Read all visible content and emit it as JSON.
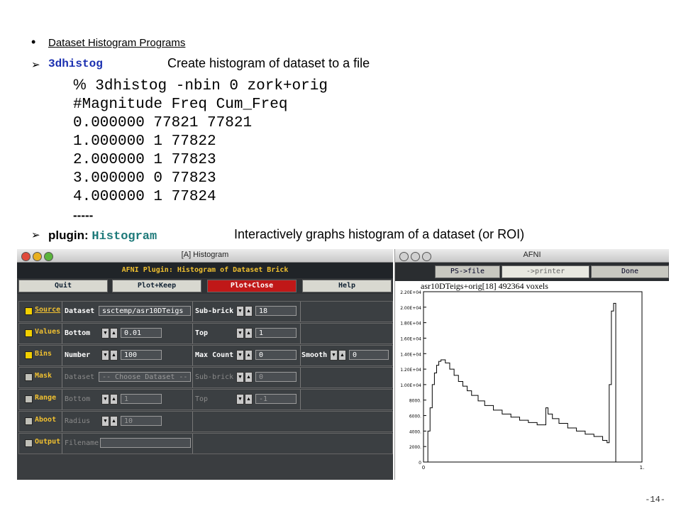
{
  "bullet1": {
    "text": "Dataset Histogram Programs"
  },
  "item1": {
    "cmd": "3dhistog",
    "desc": "Create histogram of dataset to a file"
  },
  "code": {
    "prompt": "%",
    "command": "3dhistog -nbin 0 zork+orig",
    "lines": [
      "#Magnitude Freq Cum_Freq",
      "0.000000 77821 77821",
      "1.000000 1 77822",
      "2.000000 1 77823",
      "3.000000 0 77823",
      "4.000000 1 77824",
      "-----"
    ]
  },
  "item2": {
    "prefix": "plugin:",
    "cmd": "Histogram",
    "desc": "Interactively graphs histogram of a dataset (or ROI)"
  },
  "page_number": "-14-",
  "plugin_window": {
    "title": "[A] Histogram",
    "header": "AFNI Plugin: Histogram of Dataset Brick",
    "buttons": [
      "Quit",
      "Plot+Keep",
      "Plot+Close",
      "Help"
    ],
    "rows": [
      {
        "label": "Source",
        "checked": true,
        "f1": "Dataset",
        "v1": "ssctemp/asr10DTeigs",
        "f2": "Sub-brick",
        "v2": "18",
        "f3": "",
        "v3": ""
      },
      {
        "label": "Values",
        "checked": true,
        "f1": "Bottom",
        "v1": "0.01",
        "f2": "Top",
        "v2": "1",
        "f3": "",
        "v3": ""
      },
      {
        "label": "Bins",
        "checked": true,
        "f1": "Number",
        "v1": "100",
        "f2": "Max Count",
        "v2": "0",
        "f3": "Smooth",
        "v3": "0"
      },
      {
        "label": "Mask",
        "checked": false,
        "f1": "Dataset",
        "v1": "-- Choose Dataset --",
        "f2": "Sub-brick",
        "v2": "0",
        "f3": "",
        "v3": ""
      },
      {
        "label": "Range",
        "checked": false,
        "f1": "Bottom",
        "v1": "1",
        "f2": "Top",
        "v2": "-1",
        "f3": "",
        "v3": ""
      },
      {
        "label": "Aboot",
        "checked": false,
        "f1": "Radius",
        "v1": "10",
        "f2": "",
        "v2": "",
        "f3": "",
        "v3": ""
      },
      {
        "label": "Output",
        "checked": false,
        "f1": "Filename",
        "v1": "",
        "f2": "",
        "v2": "",
        "f3": "",
        "v3": ""
      }
    ]
  },
  "afni_window": {
    "title": "AFNI",
    "buttons": [
      "PS->file",
      "->printer",
      "Done"
    ],
    "caption": "asr10DTeigs+orig[18] 492364 voxels"
  },
  "chart_data": {
    "type": "line",
    "title": "asr10DTeigs+orig[18] 492364 voxels",
    "xlim": [
      0,
      1.0
    ],
    "ylim": [
      0,
      22000
    ],
    "yticks": [
      "2.20E+04",
      "2.00E+04",
      "1.80E+04",
      "1.60E+04",
      "1.40E+04",
      "1.20E+04",
      "1.00E+04",
      "8000.",
      "6000.",
      "4000.",
      "2000.",
      "0"
    ],
    "xticks": [
      "0",
      "1."
    ],
    "x": [
      0,
      0.02,
      0.03,
      0.04,
      0.05,
      0.06,
      0.07,
      0.08,
      0.1,
      0.12,
      0.14,
      0.16,
      0.18,
      0.2,
      0.22,
      0.25,
      0.28,
      0.32,
      0.36,
      0.4,
      0.44,
      0.48,
      0.52,
      0.55,
      0.56,
      0.57,
      0.59,
      0.62,
      0.66,
      0.7,
      0.74,
      0.78,
      0.82,
      0.84,
      0.85,
      0.86,
      0.87,
      0.88,
      0.89
    ],
    "y": [
      0,
      4000,
      7000,
      10000,
      11500,
      12500,
      13000,
      13200,
      12800,
      12000,
      11200,
      10400,
      9800,
      9200,
      8600,
      7900,
      7300,
      6700,
      6200,
      5800,
      5400,
      5100,
      4800,
      4800,
      7000,
      6200,
      5600,
      5000,
      4400,
      4000,
      3600,
      3300,
      2800,
      2500,
      10000,
      19500,
      20500,
      0,
      0
    ]
  }
}
